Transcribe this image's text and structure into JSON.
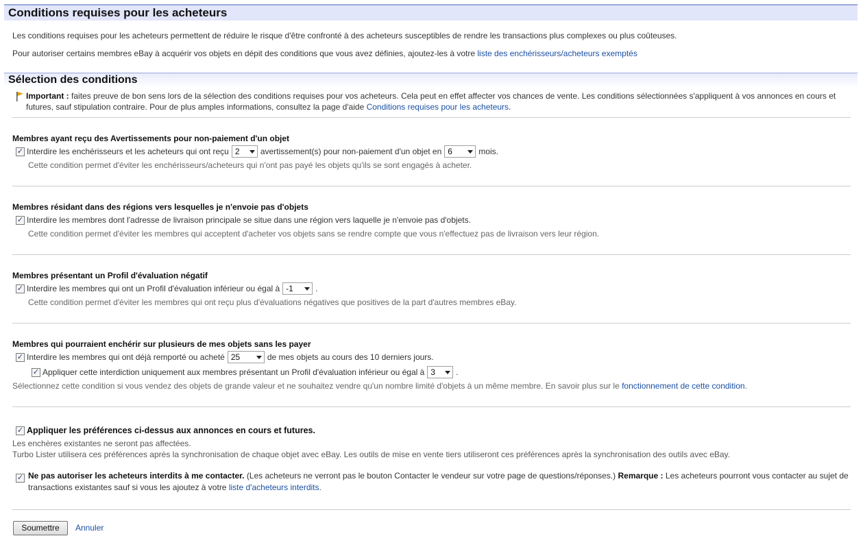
{
  "page": {
    "title": "Conditions requises pour les acheteurs",
    "intro_1": "Les conditions requises pour les acheteurs permettent de réduire le risque d'être confronté à des acheteurs susceptibles de rendre les transactions plus complexes ou plus coûteuses.",
    "intro_2": "Pour autoriser certains membres eBay à acquérir vos objets en dépit des conditions que vous avez définies, ajoutez-les à votre",
    "intro_2_link": "liste des enchérisseurs/acheteurs exemptés"
  },
  "section": {
    "title": "Sélection des conditions",
    "important_label": "Important :",
    "important_text": "faites preuve de bon sens lors de la sélection des conditions requises pour vos acheteurs. Cela peut en effet affecter vos chances de vente. Les conditions sélectionnées s'appliquent à vos annonces en cours et futures, sauf stipulation contraire. Pour de plus amples informations, consultez la page d'aide",
    "important_link": "Conditions requises pour les acheteurs",
    "important_end": "."
  },
  "group_unpaid": {
    "title": "Membres ayant reçu des Avertissements pour non-paiement d'un objet",
    "label_a": "Interdire les enchérisseurs et les acheteurs qui ont reçu",
    "select_count": "2",
    "label_b": "avertissement(s) pour non-paiement d'un objet en",
    "select_months": "6",
    "label_c": "mois.",
    "note": "Cette condition permet d'éviter les enchérisseurs/acheteurs qui n'ont pas payé les objets qu'ils se sont engagés à acheter."
  },
  "group_region": {
    "title": "Membres résidant dans des régions vers lesquelles je n'envoie pas d'objets",
    "label": "Interdire les membres dont l'adresse de livraison principale se situe dans une région vers laquelle je n'envoie pas d'objets.",
    "note": "Cette condition permet d'éviter les membres qui acceptent d'acheter vos objets sans se rendre compte que vous n'effectuez pas de livraison vers leur région."
  },
  "group_feedback": {
    "title": "Membres présentant un Profil d'évaluation négatif",
    "label_a": "Interdire les membres qui ont un Profil d'évaluation inférieur ou égal à",
    "select_value": "-1",
    "label_b": ".",
    "note": "Cette condition permet d'éviter les membres qui ont reçu plus d'évaluations négatives que positives de la part d'autres membres eBay."
  },
  "group_multi": {
    "title": "Membres qui pourraient enchérir sur plusieurs de mes objets sans les payer",
    "label_a": "Interdire les membres qui ont déjà remporté ou acheté",
    "select_items": "25",
    "label_b": "de mes objets au cours des 10 derniers jours.",
    "sub_label_a": "Appliquer cette interdiction uniquement aux membres présentant un Profil d'évaluation inférieur ou égal à",
    "sub_select": "3",
    "sub_label_b": ".",
    "note": "Sélectionnez cette condition si vous vendez des objets de grande valeur et ne souhaitez vendre qu'un nombre limité d'objets à un même membre. En savoir plus sur le",
    "note_link": "fonctionnement de cette condition",
    "note_end": "."
  },
  "apply": {
    "label": "Appliquer les préférences ci-dessus aux annonces en cours et futures.",
    "line_1": "Les enchères existantes ne seront pas affectées.",
    "line_2": "Turbo Lister utilisera ces préférences après la synchronisation de chaque objet avec eBay. Les outils de mise en vente tiers utiliseront ces préférences après la synchronisation des outils avec eBay."
  },
  "contact": {
    "label": "Ne pas autoriser les acheteurs interdits à me contacter.",
    "text": "(Les acheteurs ne verront pas le bouton Contacter le vendeur sur votre page de questions/réponses.)",
    "remark_label": "Remarque :",
    "remark_text": "Les acheteurs pourront vous contacter au sujet de transactions existantes sauf si vous les ajoutez à votre",
    "link": "liste d'acheteurs interdits",
    "end": "."
  },
  "actions": {
    "submit": "Soumettre",
    "cancel": "Annuler"
  },
  "colors": {
    "header_bg": "#e2e6fb",
    "header_border": "#9aa9da",
    "link": "#1a4fa3",
    "flag": "#e8a300"
  }
}
